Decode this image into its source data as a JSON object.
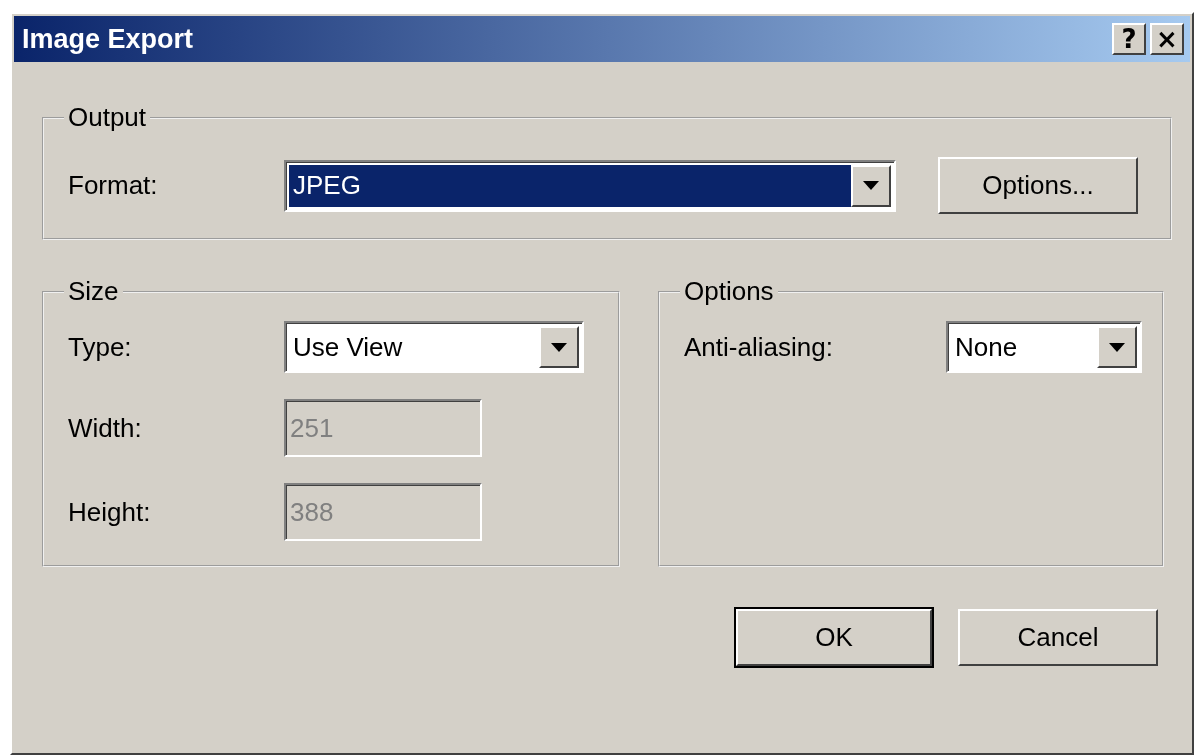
{
  "window": {
    "title": "Image Export",
    "title_buttons": [
      "?",
      "×"
    ]
  },
  "output": {
    "legend": "Output",
    "format": {
      "label": "Format:",
      "value": "JPEG",
      "focused": true
    },
    "options_button": "Options..."
  },
  "size": {
    "legend": "Size",
    "type": {
      "label": "Type:",
      "value": "Use View"
    },
    "width": {
      "label": "Width:",
      "value": "251",
      "disabled": true
    },
    "height": {
      "label": "Height:",
      "value": "388",
      "disabled": true
    }
  },
  "options": {
    "legend": "Options",
    "anti_aliasing": {
      "label": "Anti-aliasing:",
      "value": "None",
      "focused": false
    }
  },
  "buttons": [
    {
      "label": "OK",
      "default": true
    },
    {
      "label": "Cancel",
      "default": false
    }
  ]
}
